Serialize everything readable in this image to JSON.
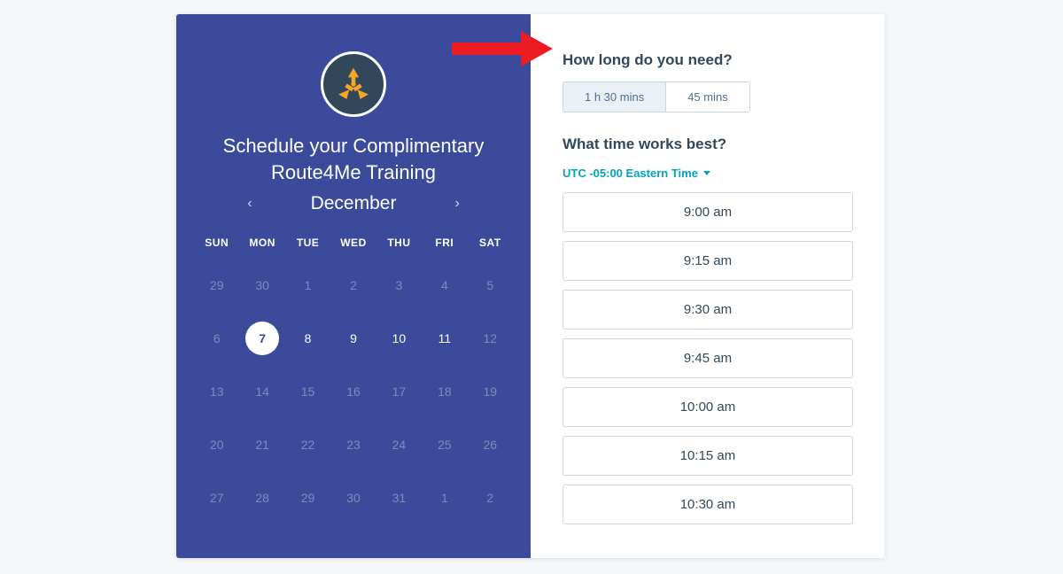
{
  "calendar": {
    "title": "Schedule your Complimentary Route4Me Training",
    "month": "December",
    "dow": [
      "SUN",
      "MON",
      "TUE",
      "WED",
      "THU",
      "FRI",
      "SAT"
    ],
    "weeks": [
      [
        {
          "n": "29",
          "dim": true
        },
        {
          "n": "30",
          "dim": true
        },
        {
          "n": "1",
          "dim": true
        },
        {
          "n": "2",
          "dim": true
        },
        {
          "n": "3",
          "dim": true
        },
        {
          "n": "4",
          "dim": true
        },
        {
          "n": "5",
          "dim": true
        }
      ],
      [
        {
          "n": "6",
          "dim": true
        },
        {
          "n": "7",
          "dim": false,
          "selected": true
        },
        {
          "n": "8",
          "dim": false
        },
        {
          "n": "9",
          "dim": false
        },
        {
          "n": "10",
          "dim": false
        },
        {
          "n": "11",
          "dim": false
        },
        {
          "n": "12",
          "dim": true
        }
      ],
      [
        {
          "n": "13",
          "dim": true
        },
        {
          "n": "14",
          "dim": true
        },
        {
          "n": "15",
          "dim": true
        },
        {
          "n": "16",
          "dim": true
        },
        {
          "n": "17",
          "dim": true
        },
        {
          "n": "18",
          "dim": true
        },
        {
          "n": "19",
          "dim": true
        }
      ],
      [
        {
          "n": "20",
          "dim": true
        },
        {
          "n": "21",
          "dim": true
        },
        {
          "n": "22",
          "dim": true
        },
        {
          "n": "23",
          "dim": true
        },
        {
          "n": "24",
          "dim": true
        },
        {
          "n": "25",
          "dim": true
        },
        {
          "n": "26",
          "dim": true
        }
      ],
      [
        {
          "n": "27",
          "dim": true
        },
        {
          "n": "28",
          "dim": true
        },
        {
          "n": "29",
          "dim": true
        },
        {
          "n": "30",
          "dim": true
        },
        {
          "n": "31",
          "dim": true
        },
        {
          "n": "1",
          "dim": true
        },
        {
          "n": "2",
          "dim": true
        }
      ]
    ]
  },
  "right": {
    "duration_question": "How long do you need?",
    "durations": [
      {
        "label": "1 h 30 mins",
        "active": true
      },
      {
        "label": "45 mins",
        "active": false
      }
    ],
    "time_question": "What time works best?",
    "timezone": "UTC -05:00 Eastern Time",
    "slots": [
      "9:00 am",
      "9:15 am",
      "9:30 am",
      "9:45 am",
      "10:00 am",
      "10:15 am",
      "10:30 am"
    ]
  }
}
